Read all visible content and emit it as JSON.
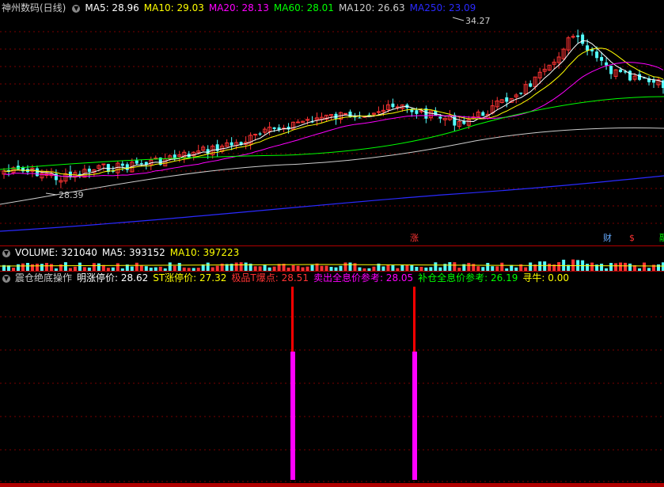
{
  "main": {
    "title": "神州数码(日线)",
    "ma": [
      {
        "label": "MA5: 28.96",
        "color": "#ffffff"
      },
      {
        "label": "MA10: 29.03",
        "color": "#ffff00"
      },
      {
        "label": "MA20: 28.13",
        "color": "#ff00ff"
      },
      {
        "label": "MA60: 28.01",
        "color": "#00ff00"
      },
      {
        "label": "MA120: 26.63",
        "color": "#cccccc"
      },
      {
        "label": "MA250: 23.09",
        "color": "#2a2aff"
      }
    ],
    "high_label": "34.27",
    "low_label": "28.39",
    "tags": [
      {
        "text": "涨",
        "color": "#ff3333"
      },
      {
        "text": "财",
        "color": "#66aaff"
      },
      {
        "text": "$",
        "color": "#ff3333"
      },
      {
        "text": "融",
        "color": "#00ff00"
      }
    ]
  },
  "volume": {
    "title": "VOLUME: 321040",
    "ma5": "MA5: 393152",
    "ma10": "MA10: 397223",
    "title_color": "#ffffff",
    "ma5_color": "#ffffff",
    "ma10_color": "#ffff00"
  },
  "indicator": {
    "title": "震仓绝底操作",
    "items": [
      {
        "label": "明涨停价: 28.62",
        "color": "#ffffff"
      },
      {
        "label": "ST涨停价: 27.32",
        "color": "#ffff00"
      },
      {
        "label": "极品T爆点: 28.51",
        "color": "#ff3333"
      },
      {
        "label": "卖出全息价参考: 28.05",
        "color": "#ff00ff"
      },
      {
        "label": "补仓全息价参考: 26.19",
        "color": "#00ff00"
      },
      {
        "label": "寻牛: 0.00",
        "color": "#ffff00"
      }
    ]
  }
}
